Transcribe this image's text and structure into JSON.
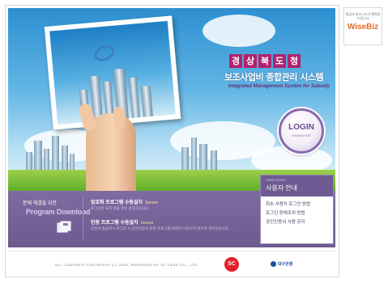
{
  "brand": {
    "title_chars": [
      "경",
      "상",
      "북",
      "도",
      "청"
    ],
    "subtitle": "보조사업비 종합관리 시스템",
    "english": "Integrated Management System for Subsidy"
  },
  "login": {
    "label": "LOGIN",
    "sub": "KWANGHOE"
  },
  "download": {
    "problem_text": "문제 해결을 위한",
    "title": "Program Download"
  },
  "install": [
    {
      "title": "암호화 프로그램 수동설치",
      "tag": "Xecure",
      "desc": "로그인이 되지 않을 경우 설치하십시오."
    },
    {
      "title": "인증 프로그램 수동설치",
      "tag": "Xecure",
      "desc": "인증서 발급이나 로그인 시 공인인증서 관련 프로그램 화면이 나타나지 않으면 설치하십시오."
    }
  ],
  "user_guide": {
    "eyebrow": "USER GUIDE",
    "title": "사용자 안내",
    "links": [
      "최초 사용자 로그인 방법",
      "로그인 장애조치 방법",
      "공인인증서 사용 공지"
    ]
  },
  "footer": {
    "copyright": "ALL CONTENTS COPYRIGHT (C) 2006, RESERVED BY SC CARD CO., LTD.",
    "sc_logo": "SC",
    "partner": "대구은행"
  },
  "wisebiz": {
    "tagline": "협업의 비즈니스가 행복을 드립니다",
    "name": "WiseBiz"
  },
  "colors": {
    "accent": "#b2226d",
    "band": "#6d5a8e",
    "sky": "#2c8fd0"
  }
}
